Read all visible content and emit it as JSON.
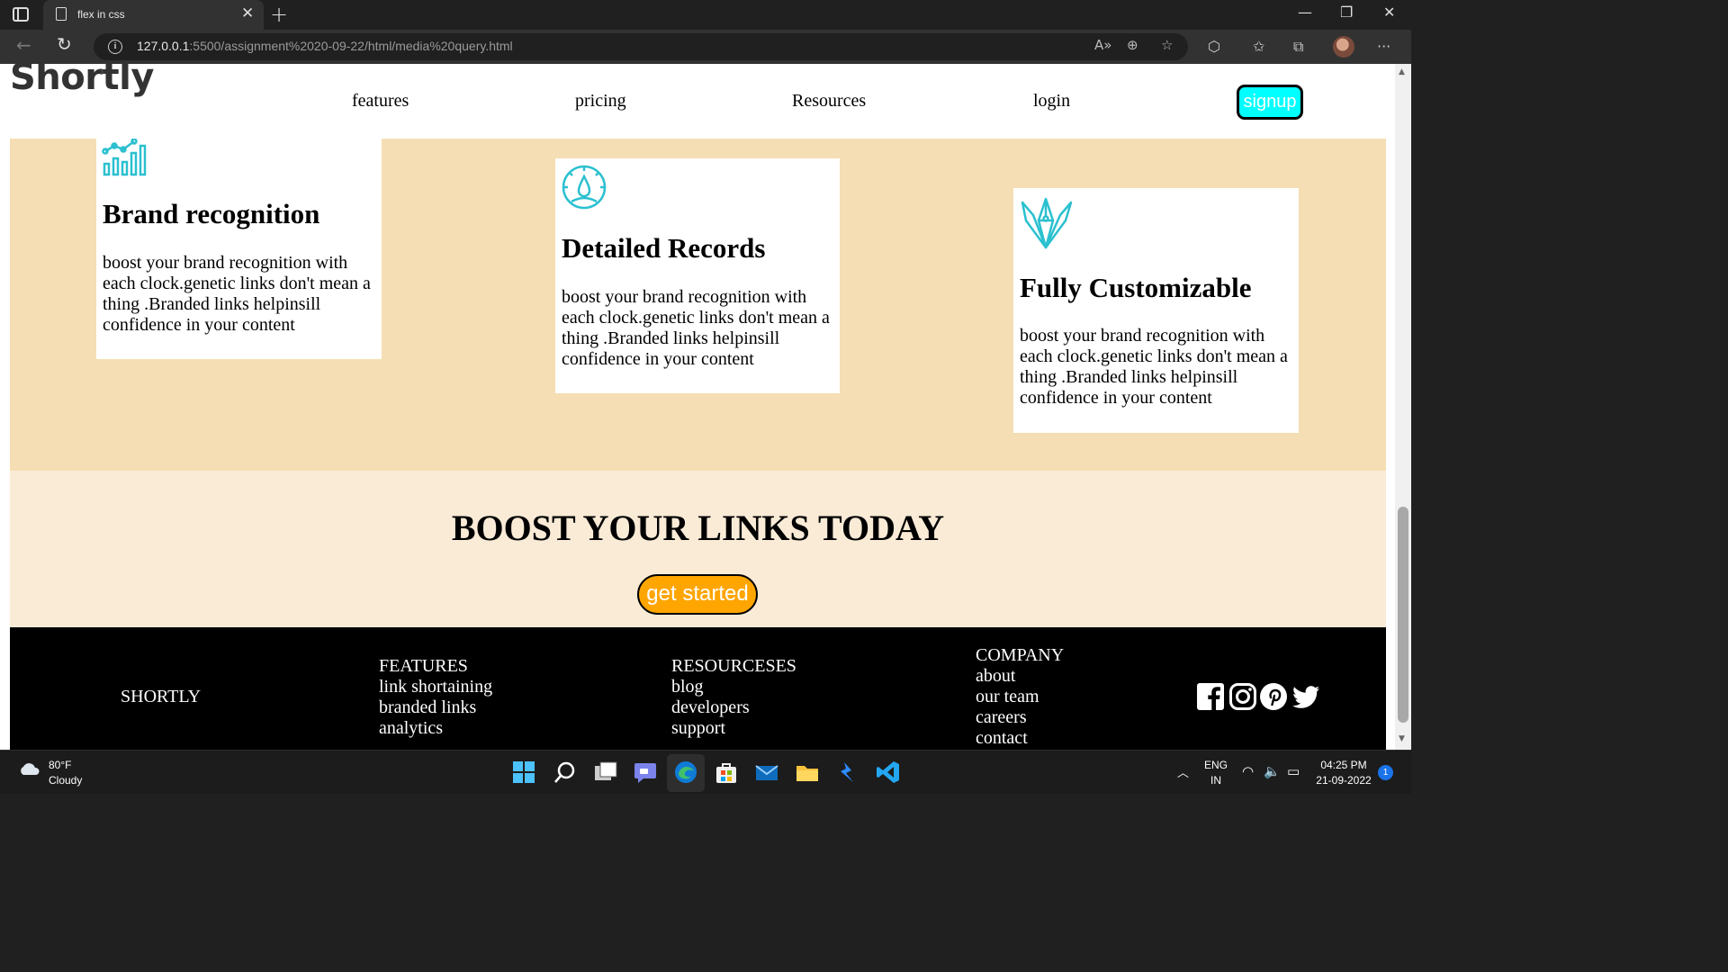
{
  "browser": {
    "tab_title": "flex in css",
    "tab_close": "✕",
    "new_tab": "+",
    "url_host": "127.0.0.1",
    "url_rest": ":5500/assignment%2020-09-22/html/media%20query.html",
    "window_controls": [
      "—",
      "❐",
      "✕"
    ]
  },
  "site": {
    "logo": "Shortly",
    "nav": [
      "features",
      "pricing",
      "Resources",
      "login"
    ],
    "signup": "signup"
  },
  "features": {
    "cards": [
      {
        "icon": "bar-chart-icon",
        "title": "Brand recognition",
        "text": "boost your brand recognition with each clock.genetic links don't mean a thing .Branded links helpinsill confidence in your content"
      },
      {
        "icon": "speedometer-icon",
        "title": "Detailed Records",
        "text": "boost your brand recognition with each clock.genetic links don't mean a thing .Branded links helpinsill confidence in your content"
      },
      {
        "icon": "brushes-icon",
        "title": "Fully Customizable",
        "text": "boost your brand recognition with each clock.genetic links don't mean a thing .Branded links helpinsill confidence in your content"
      }
    ],
    "icon_color": "#2bc0d0",
    "band_color": "#f5deb3"
  },
  "boost": {
    "title": "BOOST YOUR LINKS TODAY",
    "button": "get started",
    "band_color": "#faebd7",
    "button_color": "#ffa500"
  },
  "footer": {
    "brand": "SHORTLY",
    "columns": [
      {
        "heading": "FEATURES",
        "items": [
          "link shortaining",
          "branded links",
          "analytics"
        ]
      },
      {
        "heading": "RESOURCESES",
        "items": [
          "blog",
          "developers",
          "support"
        ]
      },
      {
        "heading": "COMPANY",
        "items": [
          "about",
          "our team",
          "careers",
          "contact"
        ]
      }
    ],
    "social": [
      "facebook-icon",
      "instagram-icon",
      "pinterest-icon",
      "twitter-icon"
    ]
  },
  "taskbar": {
    "temp": "80°F",
    "condition": "Cloudy",
    "lang_top": "ENG",
    "lang_bottom": "IN",
    "time": "04:25 PM",
    "date": "21-09-2022",
    "notifications": "1",
    "apps": [
      "start-icon",
      "search-icon",
      "task-view-icon",
      "teams-chat-icon",
      "edge-icon",
      "store-icon",
      "mail-icon",
      "file-explorer-icon",
      "power-automate-icon",
      "vscode-icon"
    ]
  }
}
